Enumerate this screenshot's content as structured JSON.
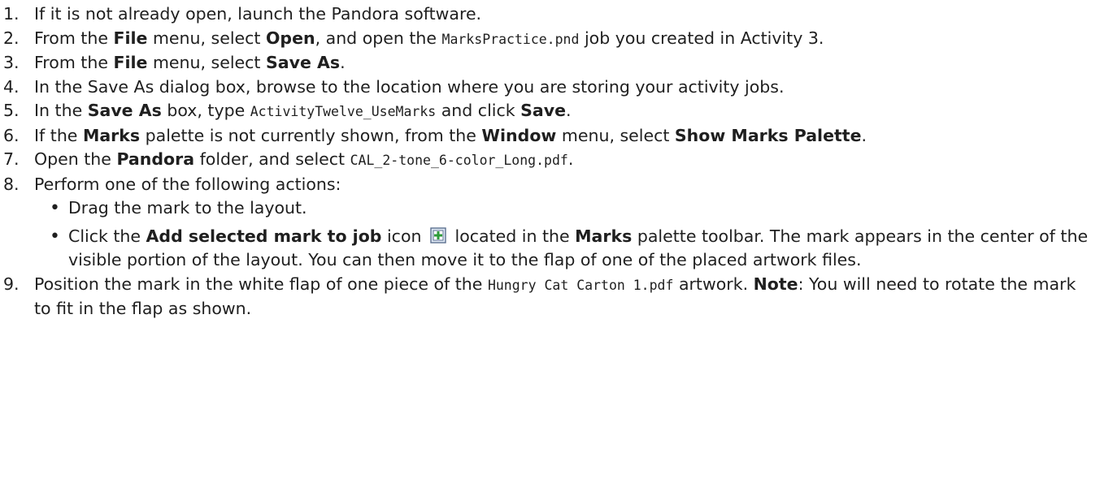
{
  "steps": [
    {
      "n": "1.",
      "parts": [
        {
          "t": "If it is not already open, launch the Pandora software."
        }
      ]
    },
    {
      "n": "2.",
      "parts": [
        {
          "t": "From the "
        },
        {
          "t": "File",
          "b": true
        },
        {
          "t": " menu, select "
        },
        {
          "t": "Open",
          "b": true
        },
        {
          "t": ", and open the "
        },
        {
          "t": "MarksPractice.pnd",
          "c": true
        },
        {
          "t": " job you created in Activity 3."
        }
      ]
    },
    {
      "n": "3.",
      "parts": [
        {
          "t": "From the "
        },
        {
          "t": "File",
          "b": true
        },
        {
          "t": " menu, select "
        },
        {
          "t": "Save As",
          "b": true
        },
        {
          "t": "."
        }
      ]
    },
    {
      "n": "4.",
      "parts": [
        {
          "t": "In the Save As dialog box, browse to the location where you are storing your activity jobs."
        }
      ]
    },
    {
      "n": "5.",
      "parts": [
        {
          "t": "In the "
        },
        {
          "t": "Save As",
          "b": true
        },
        {
          "t": " box, type "
        },
        {
          "t": "ActivityTwelve_UseMarks",
          "c": true
        },
        {
          "t": " and click "
        },
        {
          "t": "Save",
          "b": true
        },
        {
          "t": "."
        }
      ]
    },
    {
      "n": "6.",
      "parts": [
        {
          "t": "If the "
        },
        {
          "t": "Marks",
          "b": true
        },
        {
          "t": " palette is not currently shown, from the "
        },
        {
          "t": "Window",
          "b": true
        },
        {
          "t": " menu, select "
        },
        {
          "t": "Show Marks Palette",
          "b": true
        },
        {
          "t": "."
        }
      ]
    },
    {
      "n": "7.",
      "parts": [
        {
          "t": "Open the "
        },
        {
          "t": "Pandora",
          "b": true
        },
        {
          "t": " folder, and select "
        },
        {
          "t": "CAL_2-tone_6-color_Long.pdf",
          "c": true
        },
        {
          "t": "."
        }
      ]
    },
    {
      "n": "8.",
      "parts": [
        {
          "t": "Perform one of the following actions:"
        }
      ],
      "bullets": [
        [
          {
            "t": "Drag the mark to the layout."
          }
        ],
        [
          {
            "t": "Click the "
          },
          {
            "t": "Add selected mark to job",
            "b": true
          },
          {
            "t": " icon "
          },
          {
            "icon": "add-mark-icon"
          },
          {
            "t": " located in the "
          },
          {
            "t": "Marks",
            "b": true
          },
          {
            "t": " palette toolbar. The mark appears in the center of the visible portion of the layout. You can then move it to the flap of one of the placed artwork files."
          }
        ]
      ]
    },
    {
      "n": "9.",
      "parts": [
        {
          "t": "Position the mark in the white flap of one piece of the "
        },
        {
          "t": "Hungry Cat Carton 1.pdf",
          "c": true
        },
        {
          "t": " artwork. "
        },
        {
          "t": "Note",
          "b": true
        },
        {
          "t": ": You will need to rotate the mark to fit in the flap as shown."
        }
      ]
    }
  ],
  "colors": {
    "text": "#1f1f1f",
    "icon_border": "#5a6f8f",
    "icon_fill": "#dfe8f4",
    "icon_green": "#2e9b3a"
  }
}
